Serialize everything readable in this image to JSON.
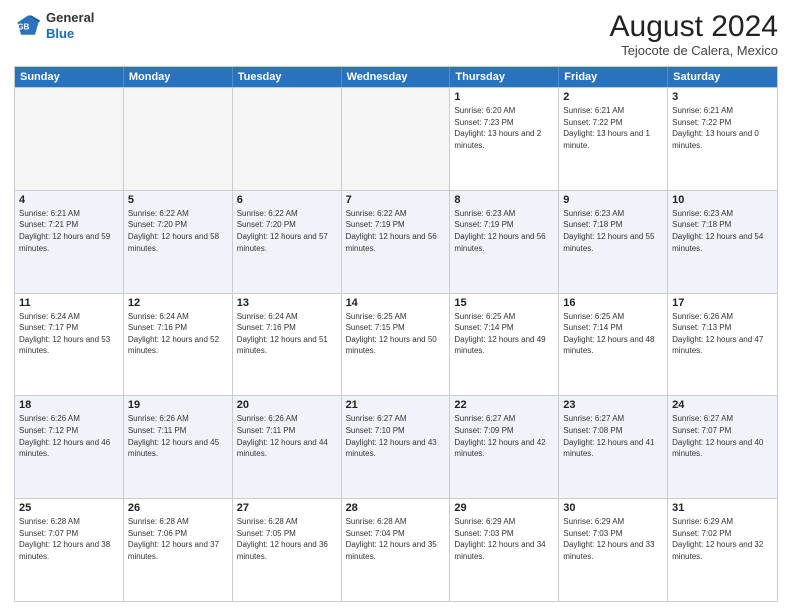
{
  "header": {
    "logo_line1": "General",
    "logo_line2": "Blue",
    "month_year": "August 2024",
    "location": "Tejocote de Calera, Mexico"
  },
  "calendar": {
    "days_of_week": [
      "Sunday",
      "Monday",
      "Tuesday",
      "Wednesday",
      "Thursday",
      "Friday",
      "Saturday"
    ],
    "rows": [
      [
        {
          "day": "",
          "sunrise": "",
          "sunset": "",
          "daylight": "",
          "empty": true
        },
        {
          "day": "",
          "sunrise": "",
          "sunset": "",
          "daylight": "",
          "empty": true
        },
        {
          "day": "",
          "sunrise": "",
          "sunset": "",
          "daylight": "",
          "empty": true
        },
        {
          "day": "",
          "sunrise": "",
          "sunset": "",
          "daylight": "",
          "empty": true
        },
        {
          "day": "1",
          "sunrise": "Sunrise: 6:20 AM",
          "sunset": "Sunset: 7:23 PM",
          "daylight": "Daylight: 13 hours and 2 minutes."
        },
        {
          "day": "2",
          "sunrise": "Sunrise: 6:21 AM",
          "sunset": "Sunset: 7:22 PM",
          "daylight": "Daylight: 13 hours and 1 minute."
        },
        {
          "day": "3",
          "sunrise": "Sunrise: 6:21 AM",
          "sunset": "Sunset: 7:22 PM",
          "daylight": "Daylight: 13 hours and 0 minutes."
        }
      ],
      [
        {
          "day": "4",
          "sunrise": "Sunrise: 6:21 AM",
          "sunset": "Sunset: 7:21 PM",
          "daylight": "Daylight: 12 hours and 59 minutes."
        },
        {
          "day": "5",
          "sunrise": "Sunrise: 6:22 AM",
          "sunset": "Sunset: 7:20 PM",
          "daylight": "Daylight: 12 hours and 58 minutes."
        },
        {
          "day": "6",
          "sunrise": "Sunrise: 6:22 AM",
          "sunset": "Sunset: 7:20 PM",
          "daylight": "Daylight: 12 hours and 57 minutes."
        },
        {
          "day": "7",
          "sunrise": "Sunrise: 6:22 AM",
          "sunset": "Sunset: 7:19 PM",
          "daylight": "Daylight: 12 hours and 56 minutes."
        },
        {
          "day": "8",
          "sunrise": "Sunrise: 6:23 AM",
          "sunset": "Sunset: 7:19 PM",
          "daylight": "Daylight: 12 hours and 56 minutes."
        },
        {
          "day": "9",
          "sunrise": "Sunrise: 6:23 AM",
          "sunset": "Sunset: 7:18 PM",
          "daylight": "Daylight: 12 hours and 55 minutes."
        },
        {
          "day": "10",
          "sunrise": "Sunrise: 6:23 AM",
          "sunset": "Sunset: 7:18 PM",
          "daylight": "Daylight: 12 hours and 54 minutes."
        }
      ],
      [
        {
          "day": "11",
          "sunrise": "Sunrise: 6:24 AM",
          "sunset": "Sunset: 7:17 PM",
          "daylight": "Daylight: 12 hours and 53 minutes."
        },
        {
          "day": "12",
          "sunrise": "Sunrise: 6:24 AM",
          "sunset": "Sunset: 7:16 PM",
          "daylight": "Daylight: 12 hours and 52 minutes."
        },
        {
          "day": "13",
          "sunrise": "Sunrise: 6:24 AM",
          "sunset": "Sunset: 7:16 PM",
          "daylight": "Daylight: 12 hours and 51 minutes."
        },
        {
          "day": "14",
          "sunrise": "Sunrise: 6:25 AM",
          "sunset": "Sunset: 7:15 PM",
          "daylight": "Daylight: 12 hours and 50 minutes."
        },
        {
          "day": "15",
          "sunrise": "Sunrise: 6:25 AM",
          "sunset": "Sunset: 7:14 PM",
          "daylight": "Daylight: 12 hours and 49 minutes."
        },
        {
          "day": "16",
          "sunrise": "Sunrise: 6:25 AM",
          "sunset": "Sunset: 7:14 PM",
          "daylight": "Daylight: 12 hours and 48 minutes."
        },
        {
          "day": "17",
          "sunrise": "Sunrise: 6:26 AM",
          "sunset": "Sunset: 7:13 PM",
          "daylight": "Daylight: 12 hours and 47 minutes."
        }
      ],
      [
        {
          "day": "18",
          "sunrise": "Sunrise: 6:26 AM",
          "sunset": "Sunset: 7:12 PM",
          "daylight": "Daylight: 12 hours and 46 minutes."
        },
        {
          "day": "19",
          "sunrise": "Sunrise: 6:26 AM",
          "sunset": "Sunset: 7:11 PM",
          "daylight": "Daylight: 12 hours and 45 minutes."
        },
        {
          "day": "20",
          "sunrise": "Sunrise: 6:26 AM",
          "sunset": "Sunset: 7:11 PM",
          "daylight": "Daylight: 12 hours and 44 minutes."
        },
        {
          "day": "21",
          "sunrise": "Sunrise: 6:27 AM",
          "sunset": "Sunset: 7:10 PM",
          "daylight": "Daylight: 12 hours and 43 minutes."
        },
        {
          "day": "22",
          "sunrise": "Sunrise: 6:27 AM",
          "sunset": "Sunset: 7:09 PM",
          "daylight": "Daylight: 12 hours and 42 minutes."
        },
        {
          "day": "23",
          "sunrise": "Sunrise: 6:27 AM",
          "sunset": "Sunset: 7:08 PM",
          "daylight": "Daylight: 12 hours and 41 minutes."
        },
        {
          "day": "24",
          "sunrise": "Sunrise: 6:27 AM",
          "sunset": "Sunset: 7:07 PM",
          "daylight": "Daylight: 12 hours and 40 minutes."
        }
      ],
      [
        {
          "day": "25",
          "sunrise": "Sunrise: 6:28 AM",
          "sunset": "Sunset: 7:07 PM",
          "daylight": "Daylight: 12 hours and 38 minutes."
        },
        {
          "day": "26",
          "sunrise": "Sunrise: 6:28 AM",
          "sunset": "Sunset: 7:06 PM",
          "daylight": "Daylight: 12 hours and 37 minutes."
        },
        {
          "day": "27",
          "sunrise": "Sunrise: 6:28 AM",
          "sunset": "Sunset: 7:05 PM",
          "daylight": "Daylight: 12 hours and 36 minutes."
        },
        {
          "day": "28",
          "sunrise": "Sunrise: 6:28 AM",
          "sunset": "Sunset: 7:04 PM",
          "daylight": "Daylight: 12 hours and 35 minutes."
        },
        {
          "day": "29",
          "sunrise": "Sunrise: 6:29 AM",
          "sunset": "Sunset: 7:03 PM",
          "daylight": "Daylight: 12 hours and 34 minutes."
        },
        {
          "day": "30",
          "sunrise": "Sunrise: 6:29 AM",
          "sunset": "Sunset: 7:03 PM",
          "daylight": "Daylight: 12 hours and 33 minutes."
        },
        {
          "day": "31",
          "sunrise": "Sunrise: 6:29 AM",
          "sunset": "Sunset: 7:02 PM",
          "daylight": "Daylight: 12 hours and 32 minutes."
        }
      ]
    ]
  }
}
